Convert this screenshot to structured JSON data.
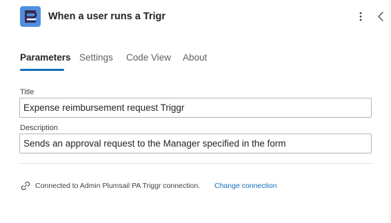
{
  "header": {
    "title": "When a user runs a Trigr",
    "logo_icon": "plumsail-logo-icon",
    "more_icon": "more-vertical-icon",
    "collapse_icon": "chevron-left-icon"
  },
  "tabs": [
    {
      "label": "Parameters",
      "active": true
    },
    {
      "label": "Settings",
      "active": false
    },
    {
      "label": "Code View",
      "active": false
    },
    {
      "label": "About",
      "active": false
    }
  ],
  "fields": {
    "title": {
      "label": "Title",
      "value": "Expense reimbursement request Triggr"
    },
    "description": {
      "label": "Description",
      "value": "Sends an approval request to the Manager specified in the form"
    }
  },
  "connection": {
    "icon": "link-icon",
    "text": "Connected to Admin Plumsail PA Triggr connection.",
    "link_label": "Change connection"
  },
  "colors": {
    "accent": "#0f6cbd",
    "logo_bg": "#4f8fe0",
    "logo_mark": "#3a2a4d"
  }
}
